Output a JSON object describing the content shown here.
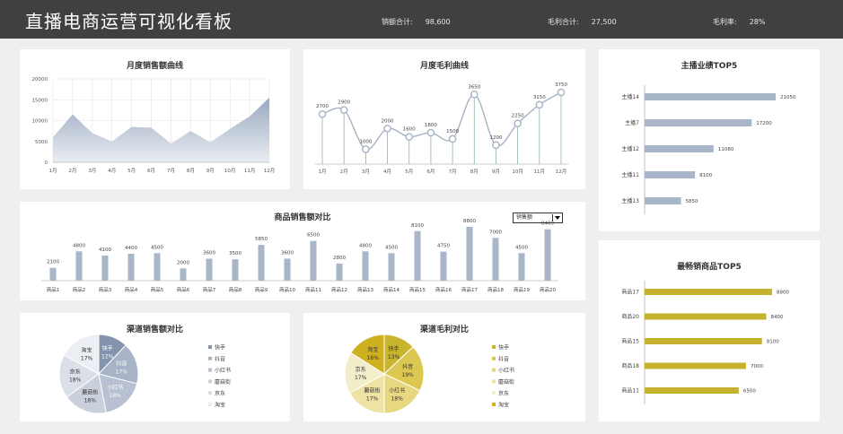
{
  "header": {
    "title": "直播电商运营可视化看板",
    "sales_label": "销额合计:",
    "sales_value": "98,600",
    "profit_label": "毛利合计:",
    "profit_value": "27,500",
    "margin_label": "毛利率:",
    "margin_value": "28%"
  },
  "panels": {
    "monthly_sales": "月度销售额曲线",
    "monthly_profit": "月度毛利曲线",
    "host_top5": "主播业绩TOP5",
    "product_sales": "商品销售额对比",
    "best_top5": "最畅销商品TOP5",
    "channel_sales": "渠道销售额对比",
    "channel_profit": "渠道毛利对比"
  },
  "dropdown": {
    "selected": "销售额"
  },
  "colors": {
    "header_bg": "#404040",
    "blue_gray": "#a9b6c9",
    "gold": "#c7b230",
    "area_top": "#9aa8bf",
    "line": "#a7b3c6"
  },
  "chart_data": [
    {
      "id": "monthly_sales",
      "type": "area",
      "title": "月度销售额曲线",
      "categories": [
        "1月",
        "2月",
        "3月",
        "4月",
        "5月",
        "6月",
        "7月",
        "8月",
        "9月",
        "10月",
        "11月",
        "12月"
      ],
      "values": [
        6000,
        11500,
        7000,
        5000,
        8500,
        8300,
        4500,
        7500,
        4800,
        8000,
        11000,
        15500
      ],
      "yticks": [
        "0",
        "5000",
        "10000",
        "15000",
        "20000"
      ],
      "ylim": [
        0,
        20000
      ],
      "grid": true
    },
    {
      "id": "monthly_profit",
      "type": "line",
      "title": "月度毛利曲线",
      "categories": [
        "1月",
        "2月",
        "3月",
        "4月",
        "5月",
        "6月",
        "7月",
        "8月",
        "9月",
        "10月",
        "11月",
        "12月"
      ],
      "values": [
        2700,
        2900,
        1000,
        2000,
        1600,
        1800,
        1500,
        3650,
        1200,
        2250,
        3150,
        3750
      ],
      "labels": [
        "2700",
        "2900",
        "1000",
        "2000",
        "1600",
        "1800",
        "1500",
        "3650",
        "1200",
        "2250",
        "3150",
        "3750"
      ],
      "ylim": [
        0,
        4000
      ]
    },
    {
      "id": "host_top5",
      "type": "bar",
      "title": "主播业绩TOP5",
      "categories": [
        "主播14",
        "主播7",
        "主播12",
        "主播11",
        "主播13"
      ],
      "values": [
        21050,
        17200,
        11080,
        8100,
        5850
      ],
      "labels": [
        "21050",
        "17200",
        "11080",
        "8100",
        "5850"
      ],
      "orientation": "horizontal"
    },
    {
      "id": "product_sales",
      "type": "bar",
      "title": "商品销售额对比",
      "categories": [
        "商品1",
        "商品2",
        "商品3",
        "商品4",
        "商品5",
        "商品6",
        "商品7",
        "商品8",
        "商品9",
        "商品10",
        "商品11",
        "商品12",
        "商品13",
        "商品14",
        "商品15",
        "商品16",
        "商品17",
        "商品18",
        "商品19",
        "商品20"
      ],
      "values": [
        2100,
        4800,
        4100,
        4400,
        4500,
        2000,
        3600,
        3500,
        5850,
        3600,
        6500,
        2800,
        4800,
        4500,
        8100,
        4750,
        8800,
        7000,
        4500,
        8400
      ],
      "labels": [
        "2100",
        "4800",
        "4100",
        "4400",
        "4500",
        "2000",
        "3600",
        "3500",
        "5850",
        "3600",
        "6500",
        "2800",
        "4800",
        "4500",
        "8100",
        "4750",
        "8800",
        "7000",
        "4500",
        "8400"
      ]
    },
    {
      "id": "best_top5",
      "type": "bar",
      "title": "最畅销商品TOP5",
      "categories": [
        "商品17",
        "商品20",
        "商品15",
        "商品18",
        "商品11"
      ],
      "values": [
        8800,
        8400,
        8100,
        7000,
        6500
      ],
      "labels": [
        "8800",
        "8400",
        "8100",
        "7000",
        "6500"
      ],
      "orientation": "horizontal"
    },
    {
      "id": "channel_sales",
      "type": "pie",
      "title": "渠道销售额对比",
      "categories": [
        "快手",
        "抖音",
        "小红书",
        "蘑菇街",
        "京东",
        "淘宝"
      ],
      "values": [
        12,
        17,
        18,
        18,
        18,
        17
      ],
      "labels": [
        "12%",
        "17%",
        "18%",
        "18%",
        "18%",
        "17%"
      ],
      "colors": [
        "#8494ae",
        "#a7b3c6",
        "#b7c1d1",
        "#c9d0dc",
        "#dbe0e8",
        "#ebeef2"
      ],
      "legend": "right"
    },
    {
      "id": "channel_profit",
      "type": "pie",
      "title": "渠道毛利对比",
      "categories": [
        "快手",
        "抖音",
        "小红书",
        "蘑菇街",
        "京东",
        "淘宝"
      ],
      "values": [
        13,
        19,
        18,
        17,
        17,
        16
      ],
      "labels": [
        "13%",
        "19%",
        "18%",
        "17%",
        "17%",
        "16%"
      ],
      "colors": [
        "#c8b42d",
        "#dcc850",
        "#e7d880",
        "#eee3a4",
        "#f4edc9",
        "#cfb021"
      ],
      "legend": "right"
    }
  ]
}
